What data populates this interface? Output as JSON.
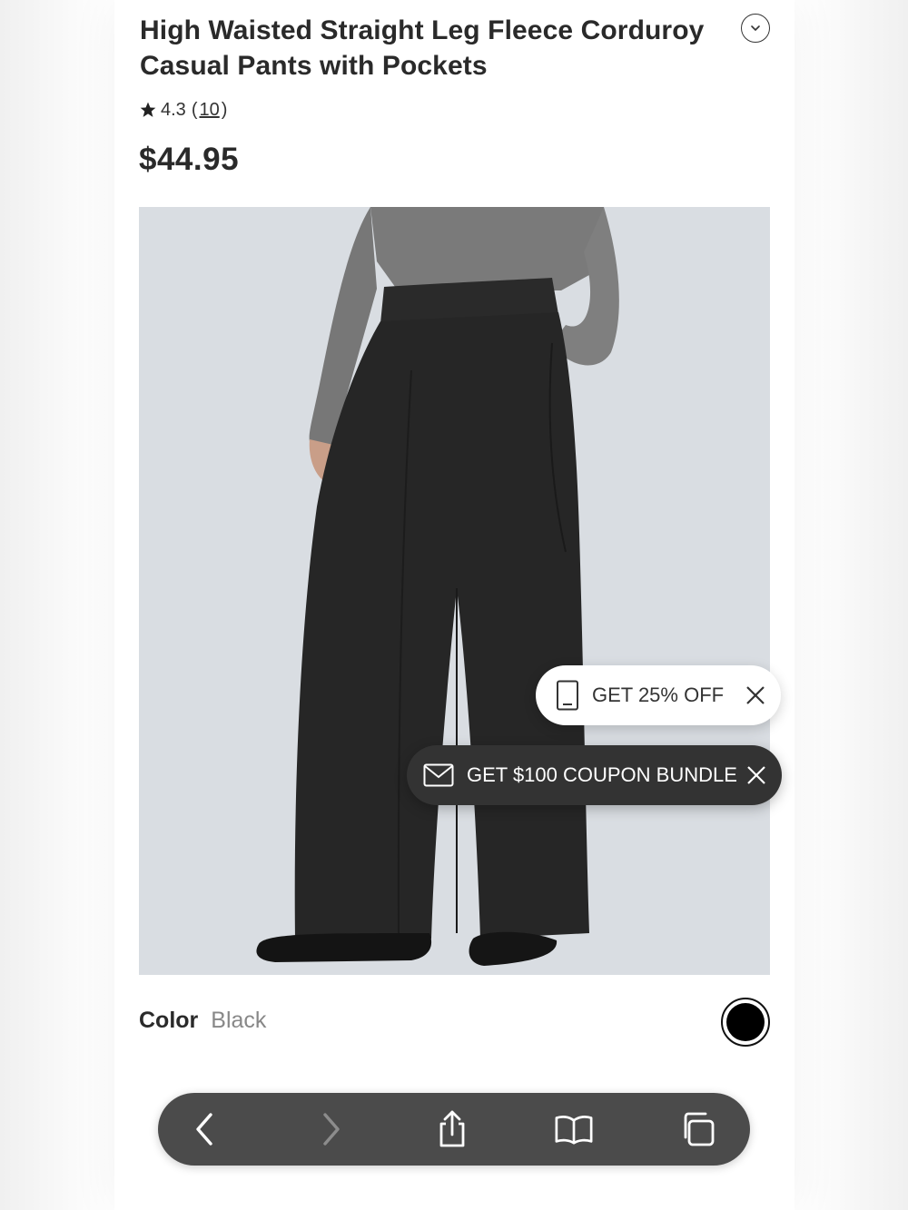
{
  "product": {
    "title": "High Waisted Straight Leg Fleece Corduroy Casual Pants with Pockets",
    "rating": "4.3",
    "review_count": "10",
    "price": "$44.95"
  },
  "promos": {
    "offer_label": "GET 25% OFF",
    "bundle_label": "GET $100 COUPON BUNDLE"
  },
  "color": {
    "label": "Color",
    "value": "Black",
    "swatch_hex": "#000000"
  },
  "icons": {
    "collapse": "chevron-down-icon",
    "star": "star-icon",
    "phone": "phone-icon",
    "mail": "mail-icon",
    "close": "close-icon",
    "back": "back-arrow-icon",
    "forward": "forward-arrow-icon",
    "share": "share-icon",
    "bookmarks": "bookmarks-icon",
    "tabs": "tabs-icon"
  }
}
